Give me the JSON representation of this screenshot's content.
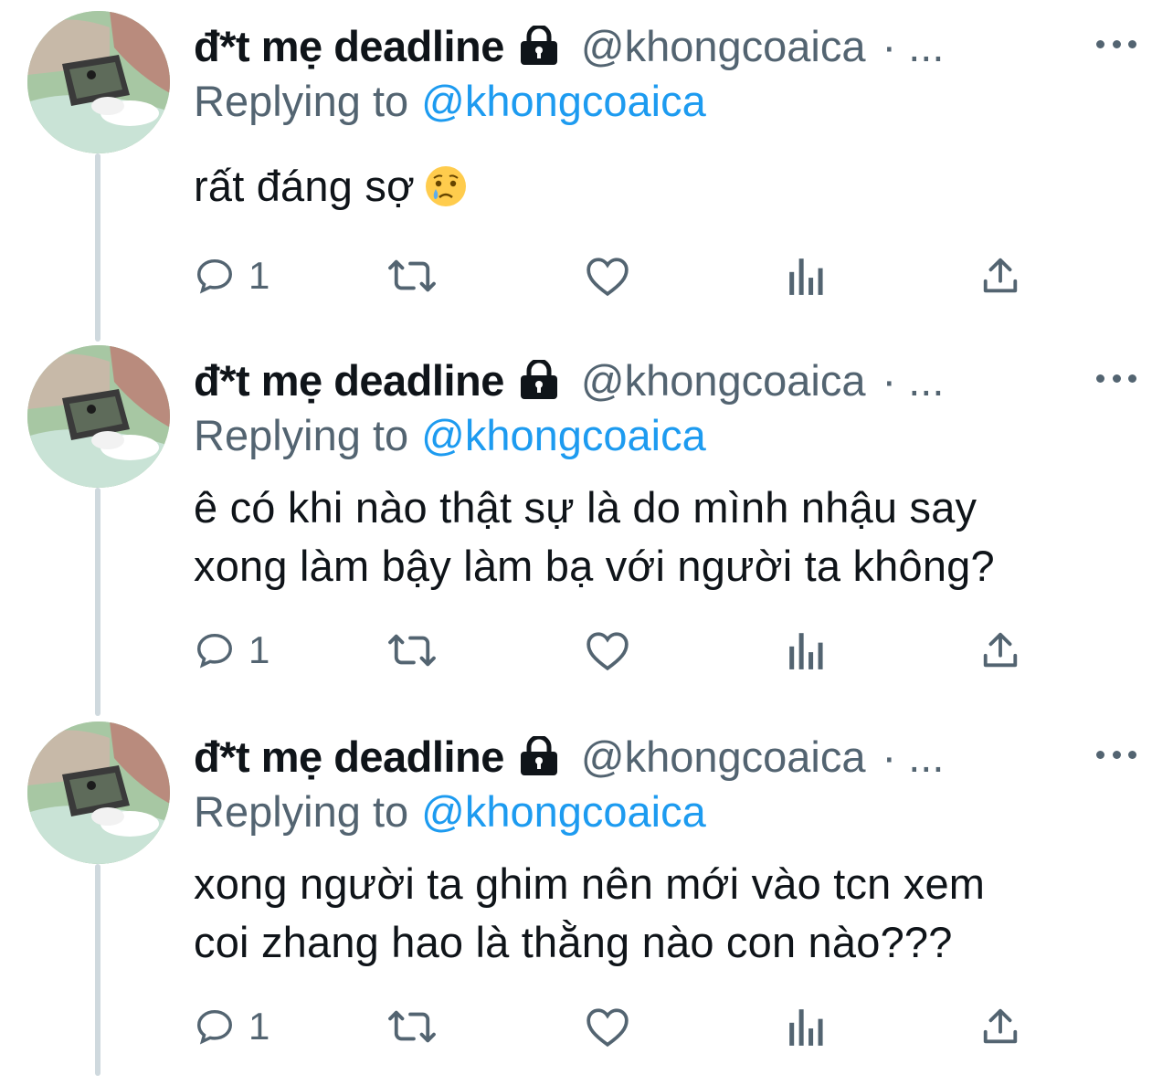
{
  "colors": {
    "text": "#0f1419",
    "secondary": "#536471",
    "link": "#1d9bf0",
    "thread_line": "#cfd9de"
  },
  "tweets": [
    {
      "name": "đ*t mẹ deadline",
      "handle": "@khongcoaica",
      "separator": "· ...",
      "replying_label": "Replying to",
      "replying_to": "@khongcoaica",
      "text": "rất đáng sợ",
      "emoji": "crying-face-emoji",
      "reply_count": "1"
    },
    {
      "name": "đ*t mẹ deadline",
      "handle": "@khongcoaica",
      "separator": "· ...",
      "replying_label": "Replying to",
      "replying_to": "@khongcoaica",
      "text_lines": [
        "ê có khi nào thật sự là do mình nhậu say",
        "xong làm bậy làm bạ với người ta không?"
      ],
      "reply_count": "1"
    },
    {
      "name": "đ*t mẹ deadline",
      "handle": "@khongcoaica",
      "separator": "· ...",
      "replying_label": "Replying to",
      "replying_to": "@khongcoaica",
      "text_lines": [
        "xong người ta ghim nên mới vào tcn xem",
        "coi zhang hao là thằng nào con nào???"
      ],
      "reply_count": "1"
    }
  ],
  "icons": {
    "lock": "lock-icon",
    "more": "more-icon",
    "reply": "reply-icon",
    "retweet": "retweet-icon",
    "like": "like-icon",
    "analytics": "analytics-icon",
    "share": "share-icon"
  }
}
